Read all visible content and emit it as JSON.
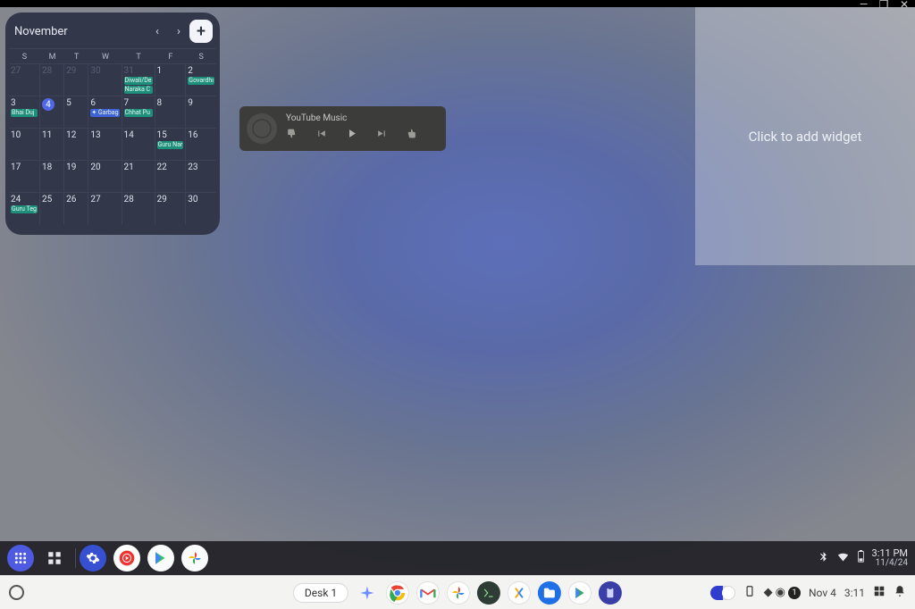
{
  "window_controls": {
    "minimize": "—",
    "restore": "❐",
    "close": "✕"
  },
  "calendar": {
    "month": "November",
    "prev": "‹",
    "next": "›",
    "add": "+",
    "dow": [
      "S",
      "M",
      "T",
      "W",
      "T",
      "F",
      "S"
    ],
    "cells": [
      {
        "n": "27",
        "dim": true
      },
      {
        "n": "28",
        "dim": true
      },
      {
        "n": "29",
        "dim": true
      },
      {
        "n": "30",
        "dim": true
      },
      {
        "n": "31",
        "dim": true,
        "events": [
          {
            "t": "Diwali/De"
          },
          {
            "t": "Naraka C"
          }
        ]
      },
      {
        "n": "1"
      },
      {
        "n": "2",
        "events": [
          {
            "t": "Govardhı"
          }
        ]
      },
      {
        "n": "3",
        "events": [
          {
            "t": "Bhai Duj"
          }
        ]
      },
      {
        "n": "4",
        "today": true
      },
      {
        "n": "5"
      },
      {
        "n": "6",
        "events": [
          {
            "t": "✦ Garbag",
            "cls": "blue"
          }
        ]
      },
      {
        "n": "7",
        "events": [
          {
            "t": "Chhat Pu"
          }
        ]
      },
      {
        "n": "8"
      },
      {
        "n": "9"
      },
      {
        "n": "10"
      },
      {
        "n": "11"
      },
      {
        "n": "12"
      },
      {
        "n": "13"
      },
      {
        "n": "14"
      },
      {
        "n": "15",
        "events": [
          {
            "t": "Guru Nar"
          }
        ]
      },
      {
        "n": "16"
      },
      {
        "n": "17"
      },
      {
        "n": "18"
      },
      {
        "n": "19"
      },
      {
        "n": "20"
      },
      {
        "n": "21"
      },
      {
        "n": "22"
      },
      {
        "n": "23"
      },
      {
        "n": "24",
        "events": [
          {
            "t": "Guru Teg"
          }
        ]
      },
      {
        "n": "25"
      },
      {
        "n": "26"
      },
      {
        "n": "27"
      },
      {
        "n": "28"
      },
      {
        "n": "29"
      },
      {
        "n": "30"
      }
    ]
  },
  "music": {
    "title": "YouTube Music",
    "thumbs_down": "👎",
    "prev": "⏮",
    "play": "▶",
    "next": "⏭",
    "thumbs_up": "👍"
  },
  "widget_slot": {
    "label": "Click to add widget"
  },
  "shelf": {
    "tray": {
      "bt": "✱",
      "wifi": "▲",
      "battery": "▮",
      "time": "3:11 PM",
      "date": "11/4/24"
    }
  },
  "taskbar": {
    "desk": "Desk 1",
    "right": {
      "date": "Nov 4",
      "time": "3:11",
      "count": "1"
    }
  }
}
